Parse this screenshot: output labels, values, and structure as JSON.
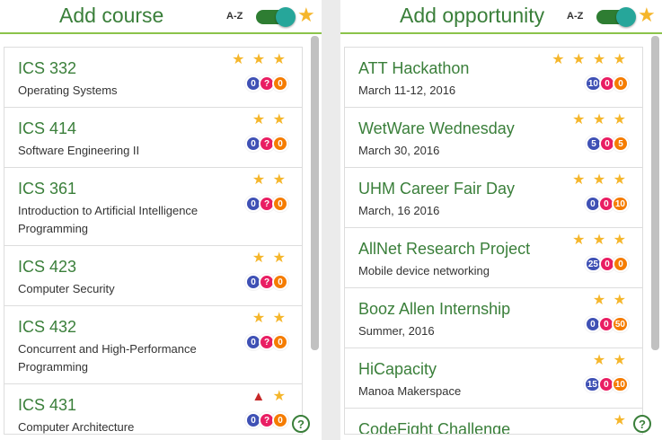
{
  "left": {
    "title": "Add course",
    "sort_label": "A-Z",
    "help_label": "?",
    "items": [
      {
        "title": "ICS 332",
        "subtitle": "Operating Systems",
        "stars": "★ ★ ★",
        "warn": "",
        "badges": [
          "0",
          "?",
          "0"
        ]
      },
      {
        "title": "ICS 414",
        "subtitle": "Software Engineering II",
        "stars": "★ ★",
        "warn": "",
        "badges": [
          "0",
          "?",
          "0"
        ]
      },
      {
        "title": "ICS 361",
        "subtitle": "Introduction to Artificial Intelligence Programming",
        "stars": "★ ★",
        "warn": "",
        "badges": [
          "0",
          "?",
          "0"
        ]
      },
      {
        "title": "ICS 423",
        "subtitle": "Computer Security",
        "stars": "★ ★",
        "warn": "",
        "badges": [
          "0",
          "?",
          "0"
        ]
      },
      {
        "title": "ICS 432",
        "subtitle": "Concurrent and High-Performance Programming",
        "stars": "★ ★",
        "warn": "",
        "badges": [
          "0",
          "?",
          "0"
        ]
      },
      {
        "title": "ICS 431",
        "subtitle": "Computer Architecture",
        "stars": "★",
        "warn": "▲",
        "badges": [
          "0",
          "?",
          "0"
        ]
      }
    ]
  },
  "right": {
    "title": "Add opportunity",
    "sort_label": "A-Z",
    "help_label": "?",
    "items": [
      {
        "title": "ATT Hackathon",
        "subtitle": "March 11-12, 2016",
        "stars": "★ ★ ★ ★",
        "badges": [
          "10",
          "0",
          "0"
        ]
      },
      {
        "title": "WetWare Wednesday",
        "subtitle": "March 30, 2016",
        "stars": "★ ★ ★",
        "badges": [
          "5",
          "0",
          "5"
        ]
      },
      {
        "title": "UHM Career Fair Day",
        "subtitle": "March, 16 2016",
        "stars": "★ ★ ★",
        "badges": [
          "0",
          "0",
          "10"
        ]
      },
      {
        "title": "AllNet Research Project",
        "subtitle": "Mobile device networking",
        "stars": "★ ★ ★",
        "badges": [
          "25",
          "0",
          "0"
        ]
      },
      {
        "title": "Booz Allen Internship",
        "subtitle": "Summer, 2016",
        "stars": "★ ★",
        "badges": [
          "0",
          "0",
          "50"
        ]
      },
      {
        "title": "HiCapacity",
        "subtitle": "Manoa Makerspace",
        "stars": "★ ★",
        "badges": [
          "15",
          "0",
          "10"
        ]
      },
      {
        "title": "CodeFight Challenge",
        "subtitle": "",
        "stars": "★",
        "badges": []
      }
    ]
  },
  "colors": {
    "title_green": "#3a7f3a",
    "star": "#f5b62b",
    "badge_blue": "#3f51b5",
    "badge_magenta": "#e91e63",
    "badge_orange": "#f57c00",
    "warn_red": "#c62828"
  },
  "icons": {
    "favorite": "star-icon",
    "help": "help-icon",
    "warning": "warning-icon"
  }
}
